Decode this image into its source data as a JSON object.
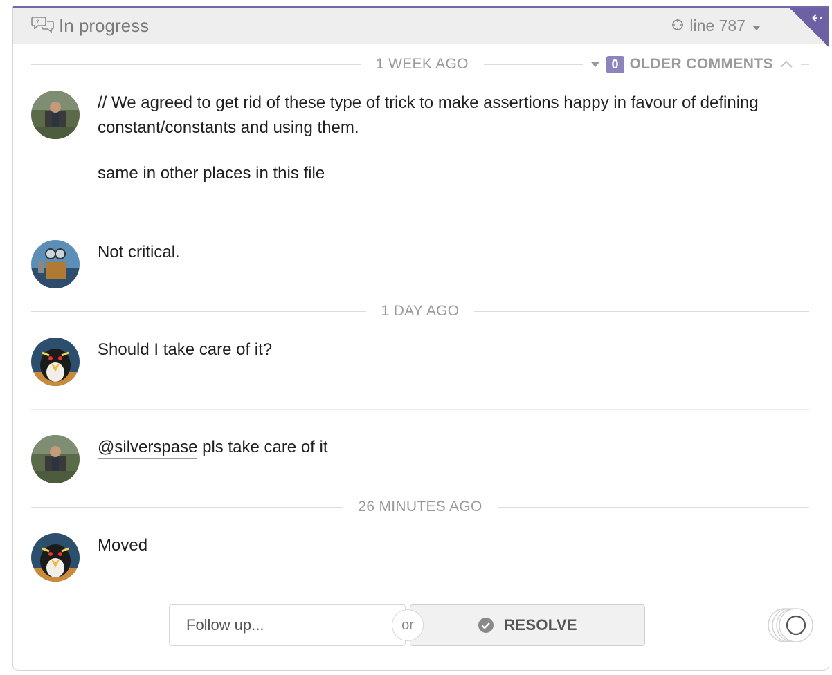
{
  "header": {
    "status": "In progress",
    "line_ref": "line 787"
  },
  "separators": {
    "week": "1 WEEK AGO",
    "day": "1 DAY AGO",
    "minutes": "26 MINUTES AGO"
  },
  "older_comments": {
    "count": "0",
    "label": "OLDER COMMENTS"
  },
  "comments": [
    {
      "paragraphs": [
        "// We agreed to get rid of these type of trick to make assertions happy in favour of defining constant/constants and using them.",
        "same in other places in this file"
      ]
    },
    {
      "text": "Not critical."
    },
    {
      "text": "Should I take care of it?"
    },
    {
      "mention": "@silverspase",
      "text": " pls take care of it"
    },
    {
      "text": "Moved"
    }
  ],
  "reply": {
    "placeholder": "Follow up...",
    "or_label": "or",
    "resolve_label": "RESOLVE"
  },
  "colors": {
    "accent": "#7468a8",
    "badge": "#8c84bd",
    "header_bg": "#eeeeee"
  }
}
